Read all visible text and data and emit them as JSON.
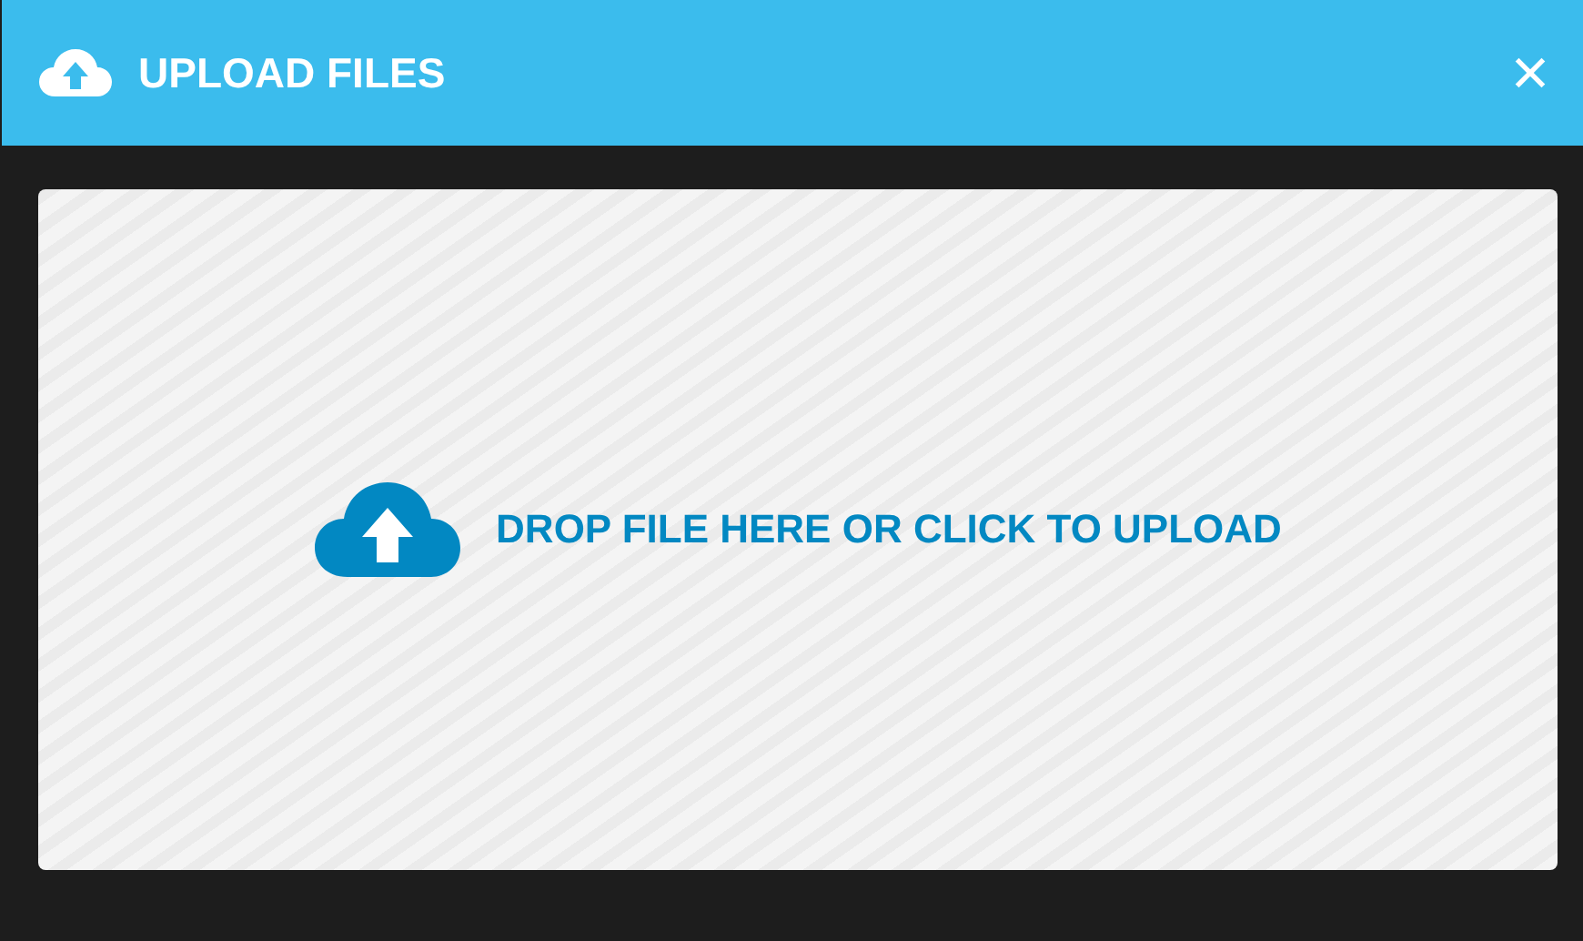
{
  "window": {
    "title": "UPLOAD FILES"
  },
  "dropzone": {
    "message": "DROP FILE HERE OR CLICK TO UPLOAD"
  }
}
